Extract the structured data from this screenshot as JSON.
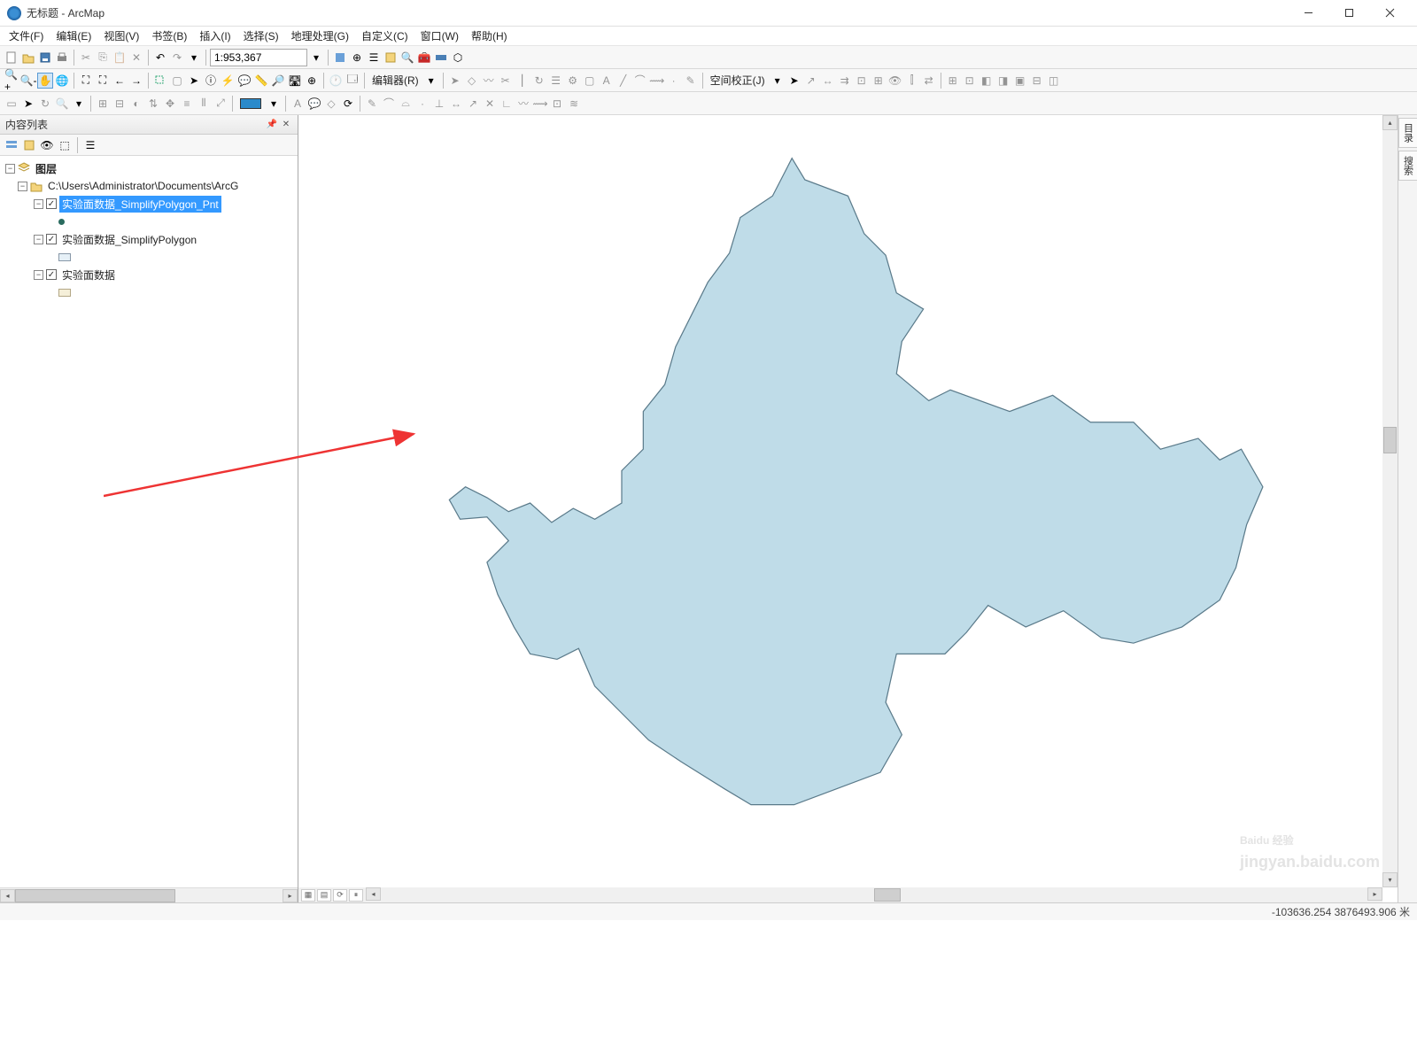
{
  "window": {
    "title": "无标题 - ArcMap"
  },
  "menu": {
    "file": "文件(F)",
    "edit": "编辑(E)",
    "view": "视图(V)",
    "bookmarks": "书签(B)",
    "insert": "插入(I)",
    "selection": "选择(S)",
    "geoproc": "地理处理(G)",
    "customize": "自定义(C)",
    "window": "窗口(W)",
    "help": "帮助(H)"
  },
  "toolbar": {
    "scale": "1:953,367",
    "editor_label": "编辑器(R)",
    "spatial_adj_label": "空间校正(J)"
  },
  "toc": {
    "title": "内容列表",
    "root": "图层",
    "dataset_path": "C:\\Users\\Administrator\\Documents\\ArcG",
    "layer1": "实验面数据_SimplifyPolygon_Pnt",
    "layer2": "实验面数据_SimplifyPolygon",
    "layer3": "实验面数据"
  },
  "right_dock": {
    "tab1": "目录",
    "tab2": "搜索"
  },
  "status": {
    "coords": "-103636.254  3876493.906 米"
  },
  "watermark": {
    "brand": "Baidu 经验",
    "sub": "jingyan.baidu.com"
  }
}
